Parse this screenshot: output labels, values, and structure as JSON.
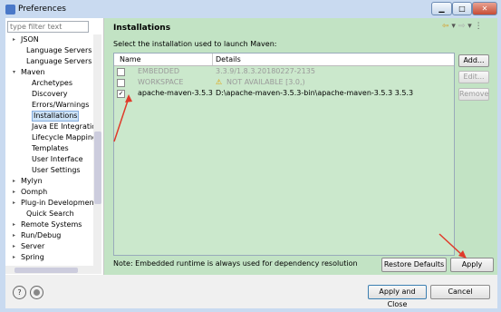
{
  "window": {
    "title": "Preferences"
  },
  "filter": {
    "placeholder": "type filter text"
  },
  "tree": [
    {
      "label": "JSON",
      "twisty": "▸"
    },
    {
      "label": "Language Servers",
      "twisty": ""
    },
    {
      "label": "Language Servers STS",
      "twisty": ""
    },
    {
      "label": "Maven",
      "twisty": "▾"
    },
    {
      "label": "Archetypes",
      "twisty": ""
    },
    {
      "label": "Discovery",
      "twisty": ""
    },
    {
      "label": "Errors/Warnings",
      "twisty": ""
    },
    {
      "label": "Installations",
      "twisty": ""
    },
    {
      "label": "Java EE Integration",
      "twisty": ""
    },
    {
      "label": "Lifecycle Mapping",
      "twisty": ""
    },
    {
      "label": "Templates",
      "twisty": ""
    },
    {
      "label": "User Interface",
      "twisty": ""
    },
    {
      "label": "User Settings",
      "twisty": ""
    },
    {
      "label": "Mylyn",
      "twisty": "▸"
    },
    {
      "label": "Oomph",
      "twisty": "▸"
    },
    {
      "label": "Plug-in Development",
      "twisty": "▸"
    },
    {
      "label": "Quick Search",
      "twisty": ""
    },
    {
      "label": "Remote Systems",
      "twisty": "▸"
    },
    {
      "label": "Run/Debug",
      "twisty": "▸"
    },
    {
      "label": "Server",
      "twisty": "▸"
    },
    {
      "label": "Spring",
      "twisty": "▸"
    }
  ],
  "page": {
    "title": "Installations",
    "subtitle": "Select the installation used to launch Maven:",
    "columns": {
      "name": "Name",
      "details": "Details"
    },
    "rows": [
      {
        "checked": "",
        "name": "EMBEDDED",
        "details": "3.3.9/1.8.3.20180227-2135",
        "disabled": true,
        "warning": ""
      },
      {
        "checked": "",
        "name": "WORKSPACE",
        "details": "NOT AVAILABLE [3.0,)",
        "disabled": true,
        "warning": "⚠"
      },
      {
        "checked": "✓",
        "name": "apache-maven-3.5.3",
        "details": "D:\\apache-maven-3.5.3-bin\\apache-maven-3.5.3 3.5.3",
        "disabled": false,
        "warning": ""
      }
    ],
    "buttons": {
      "add": "Add...",
      "edit": "Edit...",
      "remove": "Remove"
    },
    "note": "Note: Embedded runtime is always used for dependency resolution",
    "restore_defaults": "Restore Defaults",
    "apply": "Apply"
  },
  "footer": {
    "apply_close": "Apply and Close",
    "cancel": "Cancel"
  },
  "colors": {
    "page_bg": "#c2e3c4",
    "arrow": "#e03a2a"
  }
}
